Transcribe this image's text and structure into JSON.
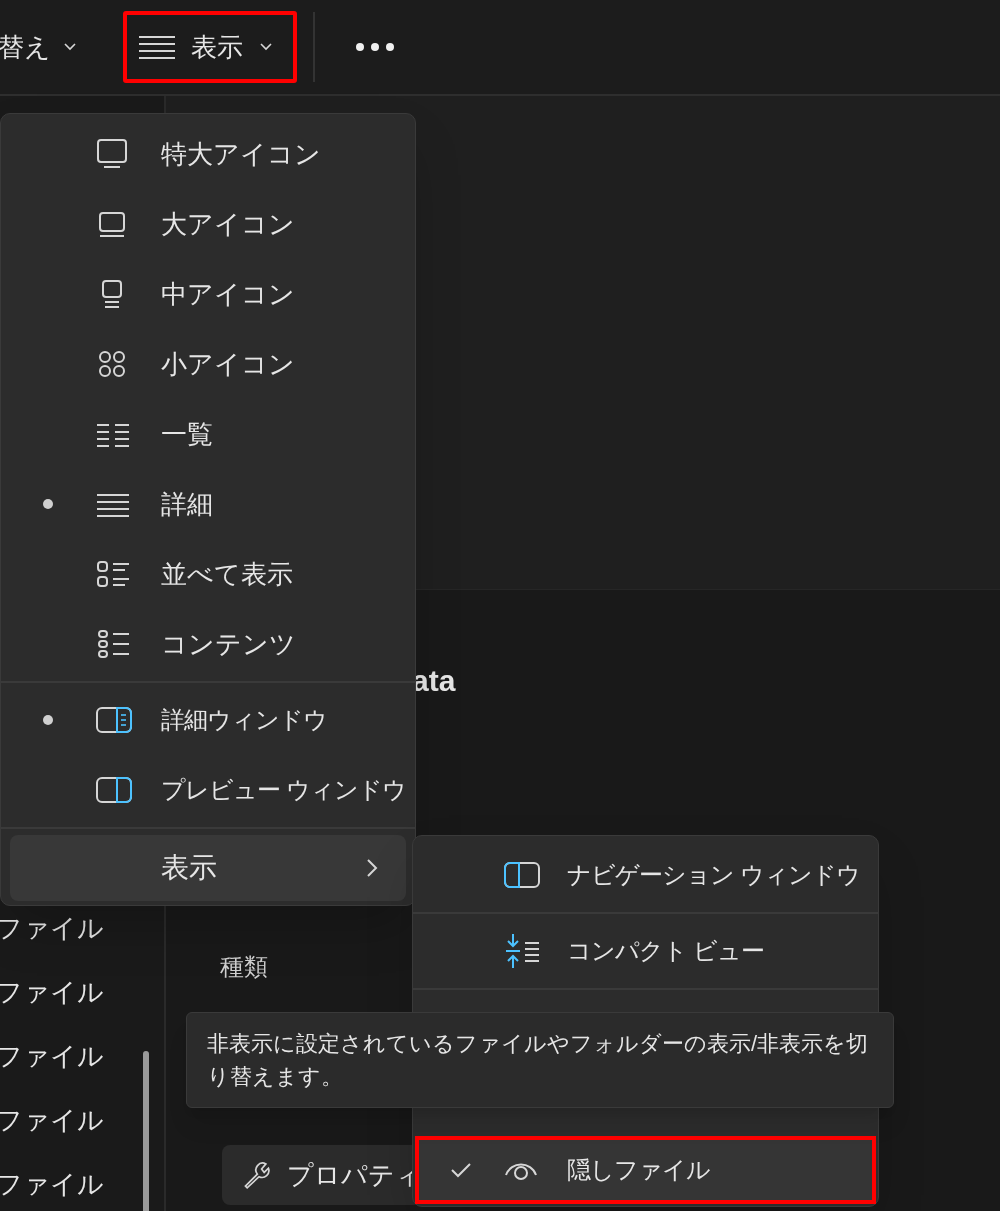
{
  "toolbar": {
    "sort_label": "替え",
    "view_button": {
      "label": "表示",
      "highlighted": true
    }
  },
  "file_list": [
    "ファイル",
    "ファイル",
    "ファイル",
    "ファイル",
    "ファイル"
  ],
  "details_pane": {
    "title": "ata",
    "properties": [
      "種類"
    ],
    "property_button": "プロパティ"
  },
  "view_menu": {
    "layouts": [
      {
        "label": "特大アイコン",
        "selected": false
      },
      {
        "label": "大アイコン",
        "selected": false
      },
      {
        "label": "中アイコン",
        "selected": false
      },
      {
        "label": "小アイコン",
        "selected": false
      },
      {
        "label": "一覧",
        "selected": false
      },
      {
        "label": "詳細",
        "selected": true
      },
      {
        "label": "並べて表示",
        "selected": false
      },
      {
        "label": "コンテンツ",
        "selected": false
      }
    ],
    "panes": [
      {
        "label": "詳細ウィンドウ",
        "selected": true
      },
      {
        "label": "プレビュー ウィンドウ",
        "selected": false
      }
    ],
    "show_item": {
      "label": "表示",
      "expanded": true
    }
  },
  "show_submenu": [
    {
      "label": "ナビゲーション ウィンドウ",
      "checked": false,
      "highlighted": false
    },
    {
      "label": "コンパクト ビュー",
      "checked": false,
      "highlighted": false
    },
    {
      "label": "隠しファイル",
      "checked": true,
      "highlighted": true
    }
  ],
  "tooltip": "非表示に設定されているファイルやフォルダーの表示/非表示を切り替えます。"
}
